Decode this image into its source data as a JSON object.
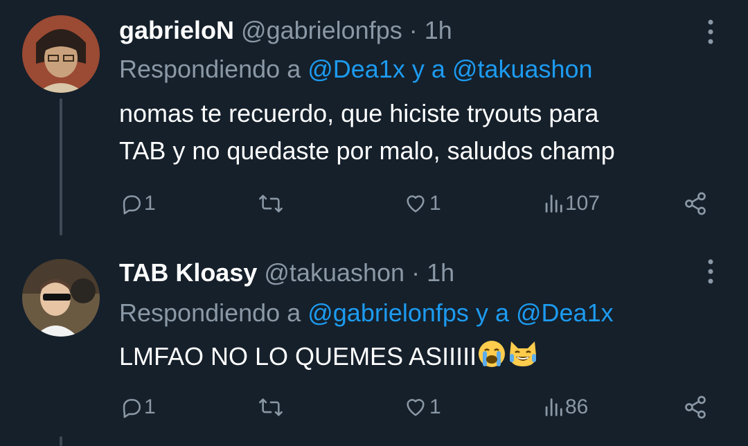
{
  "tweets": [
    {
      "display_name": "gabrieloN",
      "handle": "@gabrielonfps",
      "dot": "·",
      "time": "1h",
      "reply_prefix": "Respondiendo a",
      "reply_mention_1": "@Dea1x",
      "reply_join": "y a",
      "reply_mention_2": "@takuashon",
      "body_line_1": "nomas te recuerdo, que hiciste tryouts para",
      "body_line_2": "TAB y no quedaste por malo, saludos champ",
      "replies": "1",
      "retweets": "",
      "likes": "1",
      "views": "107"
    },
    {
      "display_name": "TAB Kloasy",
      "handle": "@takuashon",
      "dot": "·",
      "time": "1h",
      "reply_prefix": "Respondiendo a",
      "reply_mention_1": "@gabrielonfps",
      "reply_join": "y a",
      "reply_mention_2": "@Dea1x",
      "body_line_1": "LMFAO NO LO QUEMES ASIIIII",
      "body_emojis": [
        "loudly-crying-face",
        "grinning-cat-face"
      ],
      "replies": "1",
      "retweets": "",
      "likes": "1",
      "views": "86"
    }
  ],
  "colors": {
    "background": "#15202b",
    "text": "#ffffff",
    "secondary": "#8b98a5",
    "accent": "#1d9bf0",
    "thread_line": "#3d4954"
  }
}
